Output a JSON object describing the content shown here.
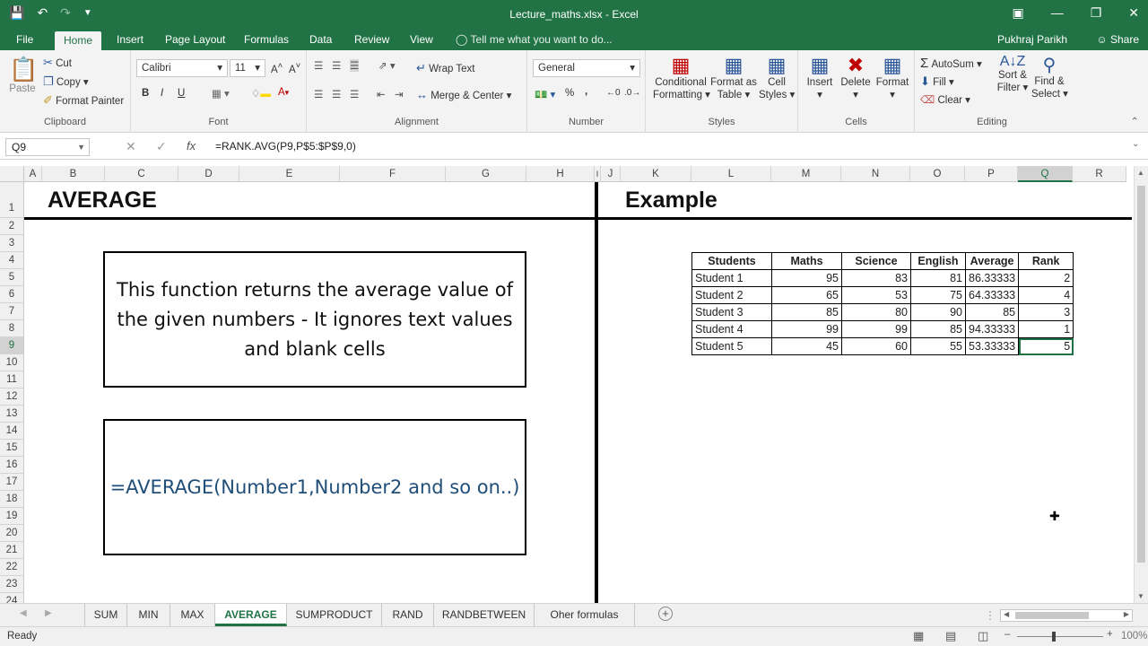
{
  "window": {
    "title": "Lecture_maths.xlsx - Excel"
  },
  "ribbon_tabs": [
    "File",
    "Home",
    "Insert",
    "Page Layout",
    "Formulas",
    "Data",
    "Review",
    "View"
  ],
  "tell_me": "Tell me what you want to do...",
  "user": "Pukhraj Parikh",
  "share": "Share",
  "clipboard": {
    "paste": "Paste",
    "cut": "Cut",
    "copy": "Copy",
    "format_painter": "Format Painter",
    "label": "Clipboard"
  },
  "font": {
    "name": "Calibri",
    "size": "11",
    "bold": "B",
    "italic": "I",
    "underline": "U",
    "label": "Font"
  },
  "alignment": {
    "wrap": "Wrap Text",
    "merge": "Merge & Center",
    "label": "Alignment"
  },
  "number": {
    "format": "General",
    "percent": "%",
    "comma": ",",
    "label": "Number"
  },
  "styles": {
    "conditional": "Conditional",
    "conditional2": "Formatting",
    "format_as": "Format as",
    "table": "Table",
    "cell": "Cell",
    "cell_styles": "Styles",
    "label": "Styles"
  },
  "cells": {
    "insert": "Insert",
    "delete": "Delete",
    "format": "Format",
    "label": "Cells"
  },
  "editing": {
    "autosum": "AutoSum",
    "fill": "Fill",
    "clear": "Clear",
    "sort": "Sort &",
    "filter": "Filter",
    "find": "Find &",
    "select": "Select",
    "label": "Editing"
  },
  "formula_bar": {
    "name_box": "Q9",
    "fx": "fx",
    "formula": "=RANK.AVG(P9,P$5:$P$9,0)"
  },
  "columns": [
    "A",
    "B",
    "C",
    "D",
    "E",
    "F",
    "G",
    "H",
    "I",
    "J",
    "K",
    "L",
    "M",
    "N",
    "O",
    "P",
    "Q",
    "R"
  ],
  "rows": [
    "1",
    "2",
    "3",
    "4",
    "5",
    "6",
    "7",
    "8",
    "9",
    "10",
    "11",
    "12",
    "13",
    "14",
    "15",
    "16",
    "17",
    "18",
    "19",
    "20",
    "21",
    "22",
    "23",
    "24"
  ],
  "sheet": {
    "left_heading": "AVERAGE",
    "right_heading": "Example",
    "description": "This function returns the average value of the given numbers - It ignores text values and blank cells",
    "syntax": "=AVERAGE(Number1,Number2 and so on..)"
  },
  "table": {
    "headers": [
      "Students",
      "Maths",
      "Science",
      "English",
      "Average",
      "Rank"
    ],
    "rows": [
      [
        "Student 1",
        "95",
        "83",
        "81",
        "86.33333",
        "2"
      ],
      [
        "Student 2",
        "65",
        "53",
        "75",
        "64.33333",
        "4"
      ],
      [
        "Student 3",
        "85",
        "80",
        "90",
        "85",
        "3"
      ],
      [
        "Student 4",
        "99",
        "99",
        "85",
        "94.33333",
        "1"
      ],
      [
        "Student 5",
        "45",
        "60",
        "55",
        "53.33333",
        "5"
      ]
    ]
  },
  "sheet_tabs": [
    "SUM",
    "MIN",
    "MAX",
    "AVERAGE",
    "SUMPRODUCT",
    "RAND",
    "RANDBETWEEN",
    "Oher formulas"
  ],
  "active_sheet": "AVERAGE",
  "status": {
    "ready": "Ready",
    "zoom": "100%"
  },
  "colors": {
    "excel_green": "#217346",
    "syntax_blue": "#1f4e79"
  }
}
